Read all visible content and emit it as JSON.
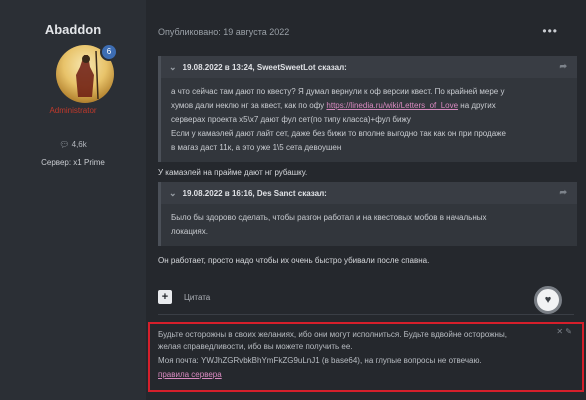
{
  "author": {
    "name": "Abaddon",
    "role": "Administrator",
    "badge": "6",
    "reactions": "4,6k",
    "server": "Сервер: x1 Prime"
  },
  "post": {
    "meta": "Опубликовано: 19 августа 2022",
    "menu_icon": "•••",
    "quote1": {
      "header": "19.08.2022 в 13:24, SweetSweetLot сказал:",
      "line1": "а что сейчас там дают по квесту? Я думал вернули к оф версии квест. По крайней мере у",
      "line2_a": "хумов дали неклю нг за квест, как по офу ",
      "link": "https://linedia.ru/wiki/Letters_of_Love",
      "line2_b": " на других",
      "line3": "серверах проекта х5\\х7 дают фул сет(по типу класса)+фул бижу",
      "line4": "Если у камаэлей дают лайт сет, даже без бижи то вполне выгодно так как он при продаже",
      "line5": "в магаз даст 11к, а это уже 1\\5 сета девоушен"
    },
    "reply1": "У камаэлей на прайме дают нг рубашку.",
    "quote2": {
      "header": "19.08.2022 в 16:16, Des Sanct сказал:",
      "line1": "Было бы здорово сделать, чтобы разгон работал и на квестовых мобов в начальных",
      "line2": "локациях."
    },
    "reply2": "Он работает, просто надо чтобы их очень быстро убивали после спавна.",
    "plus": "+",
    "quote_button": "Цитата"
  },
  "signature": {
    "line1": "Будьте осторожны в своих желаниях, ибо они могут исполниться. Будьте вдвойне осторожны,",
    "line2": "желая справедливости, ибо вы можете получить ее.",
    "line3": "Моя почта: YWJhZGRvbkBhYmFkZG9uLnJ1 (в base64), на глупые вопросы не отвечаю.",
    "link": "правила сервера",
    "close": "✕ ✎"
  }
}
